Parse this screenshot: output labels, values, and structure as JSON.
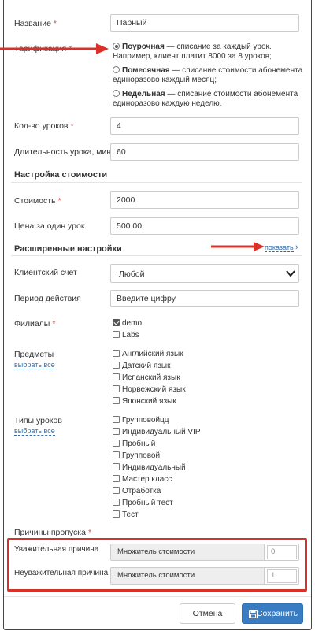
{
  "form": {
    "name": {
      "label": "Название",
      "required": "*",
      "value": "Парный"
    },
    "tariff": {
      "label": "Тарификация",
      "required": "*",
      "options": [
        {
          "title": "Поурочная",
          "rest": " — списание за каждый урок. Например, клиент платит 8000 за 8 уроков;",
          "selected": true
        },
        {
          "title": "Помесячная",
          "rest": " — списание стоимости абонемента единоразово каждый месяц;",
          "selected": false
        },
        {
          "title": "Недельная",
          "rest": " — списание стоимости абонемента единоразово каждую неделю.",
          "selected": false
        }
      ]
    },
    "lessons_count": {
      "label": "Кол-во уроков",
      "required": "*",
      "value": "4"
    },
    "duration": {
      "label": "Длительность урока, мин.",
      "value": "60"
    }
  },
  "pricing": {
    "title": "Настройка стоимости",
    "cost": {
      "label": "Стоимость",
      "required": "*",
      "value": "2000"
    },
    "per_lesson": {
      "label": "Цена за один урок",
      "value": "500.00"
    }
  },
  "advanced": {
    "title": "Расширенные настройки",
    "show_link": "показать",
    "show_chevron": "›",
    "client_account": {
      "label": "Клиентский счет",
      "value": "Любой"
    },
    "period": {
      "label": "Период действия",
      "placeholder": "Введите цифру"
    },
    "branches": {
      "label": "Филиалы",
      "required": "*",
      "items": [
        {
          "label": "demo",
          "checked": true
        },
        {
          "label": "Labs",
          "checked": false
        }
      ]
    },
    "subjects": {
      "label": "Предметы",
      "select_all": "выбрать все",
      "items": [
        "Английский язык",
        "Датский язык",
        "Испанский язык",
        "Норвежский язык",
        "Японский язык"
      ]
    },
    "lesson_types": {
      "label": "Типы уроков",
      "select_all": "выбрать все",
      "items": [
        "Групповойцц",
        "Индивидуальный VIP",
        "Пробный",
        "Групповой",
        "Индивидуальный",
        "Мастер класс",
        "Отработка",
        "Пробный тест",
        "Тест"
      ]
    },
    "absence": {
      "label": "Причины пропуска",
      "required": "*",
      "rows": [
        {
          "label": "Уважительная причина",
          "multiplier_label": "Множитель стоимости",
          "value": "0"
        },
        {
          "label": "Неуважительная причина",
          "multiplier_label": "Множитель стоимости",
          "value": "1"
        }
      ]
    }
  },
  "footer": {
    "cancel": "Отмена",
    "save": "Сохранить"
  },
  "colors": {
    "accent": "#3a7cc1",
    "annotation": "#d9302a",
    "required": "#d9534f"
  }
}
